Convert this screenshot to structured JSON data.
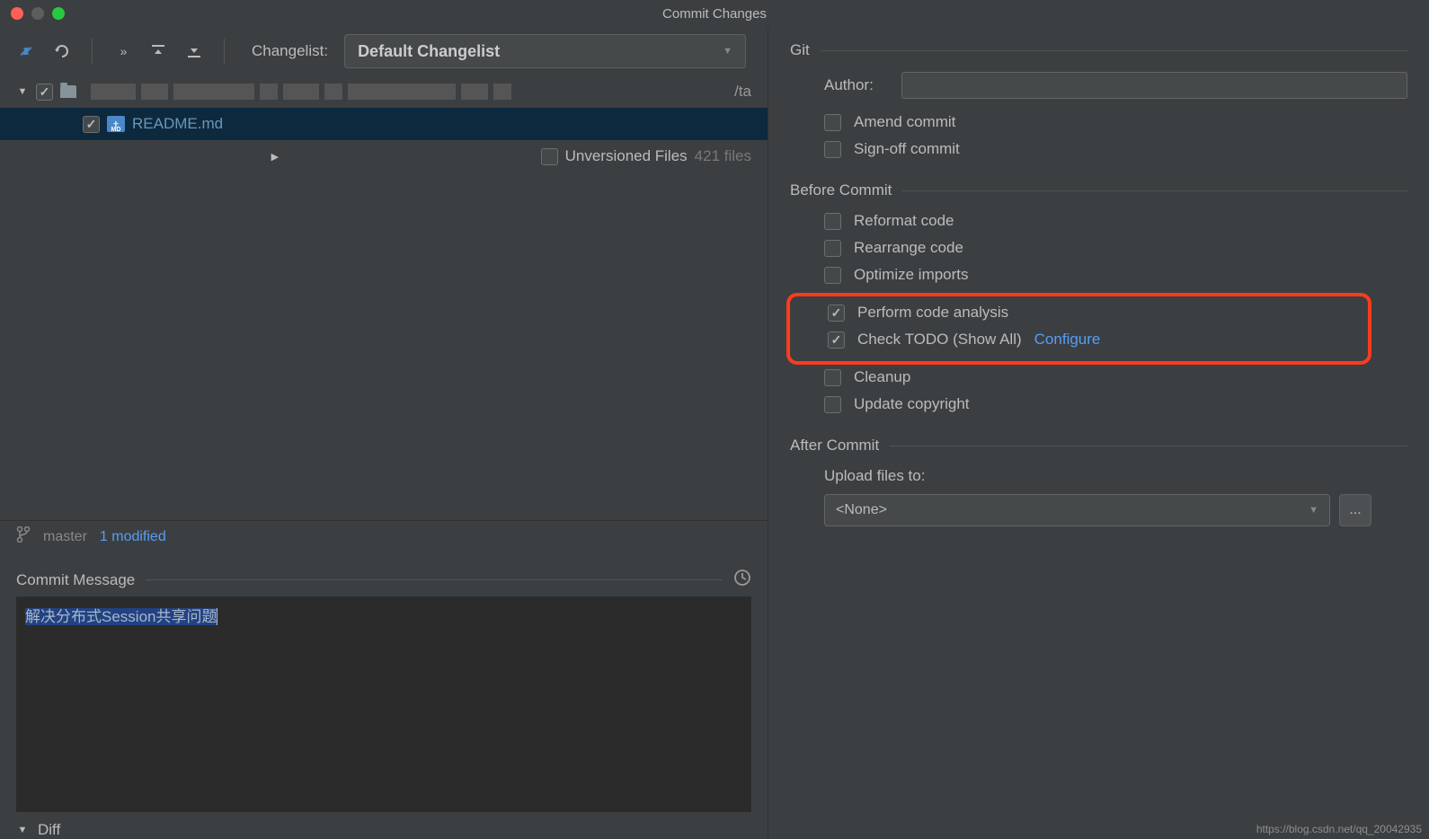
{
  "window": {
    "title": "Commit Changes"
  },
  "toolbar": {
    "changelist_label": "Changelist:",
    "changelist_value": "Default Changelist"
  },
  "tree": {
    "root_path_suffix": "/ta",
    "file1": "README.md",
    "unversioned_label": "Unversioned Files",
    "unversioned_count": "421 files"
  },
  "status": {
    "branch": "master",
    "modified": "1 modified"
  },
  "commit": {
    "section_label": "Commit Message",
    "message_text": "解决分布式Session共享问题"
  },
  "diff": {
    "label": "Diff"
  },
  "git": {
    "section_label": "Git",
    "author_label": "Author:",
    "amend_label": "Amend commit",
    "signoff_label": "Sign-off commit"
  },
  "before_commit": {
    "section_label": "Before Commit",
    "reformat": "Reformat code",
    "rearrange": "Rearrange code",
    "optimize": "Optimize imports",
    "analysis": "Perform code analysis",
    "todo": "Check TODO (Show All)",
    "configure": "Configure",
    "cleanup": "Cleanup",
    "copyright": "Update copyright"
  },
  "after_commit": {
    "section_label": "After Commit",
    "upload_label": "Upload files to:",
    "upload_value": "<None>"
  },
  "watermark": "https://blog.csdn.net/qq_20042935"
}
